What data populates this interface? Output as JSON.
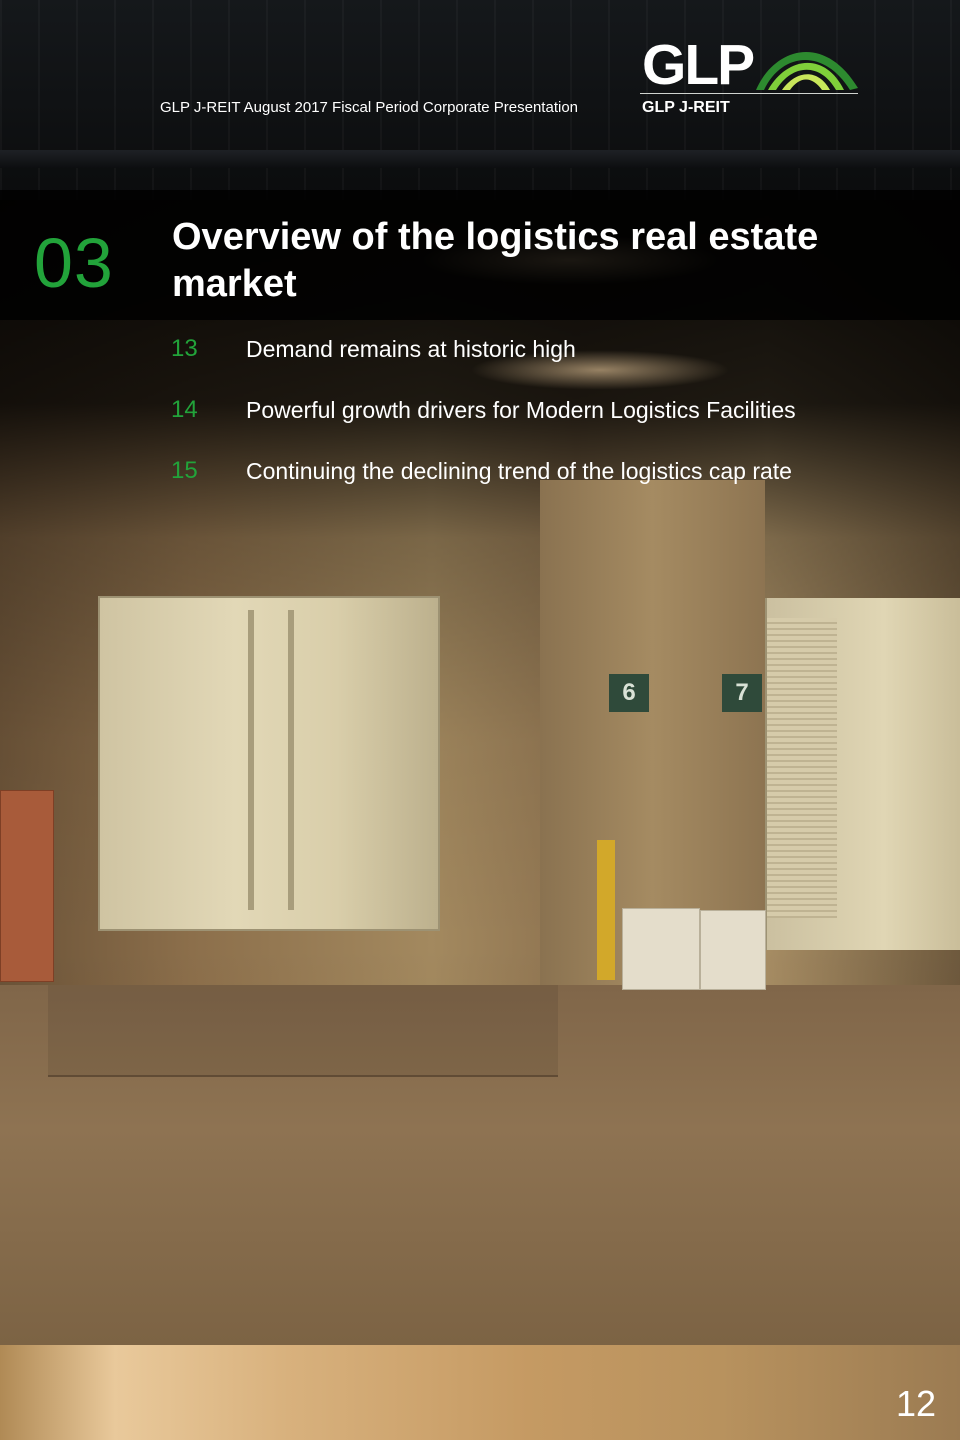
{
  "header": {
    "subtitle": "GLP J-REIT August 2017 Fiscal Period Corporate Presentation",
    "logo_text": "GLP",
    "logo_subtext": "GLP J-REIT"
  },
  "section": {
    "number": "03",
    "title": "Overview of the logistics real estate market"
  },
  "toc": [
    {
      "page": "13",
      "label": "Demand remains at historic high"
    },
    {
      "page": "14",
      "label": "Powerful growth drivers for Modern Logistics Facilities"
    },
    {
      "page": "15",
      "label": "Continuing the declining trend of the logistics cap rate"
    }
  ],
  "background": {
    "dock_signs": [
      "6",
      "7"
    ]
  },
  "page_number": "12",
  "colors": {
    "accent_green": "#22a33a",
    "text_white": "#ffffff"
  }
}
